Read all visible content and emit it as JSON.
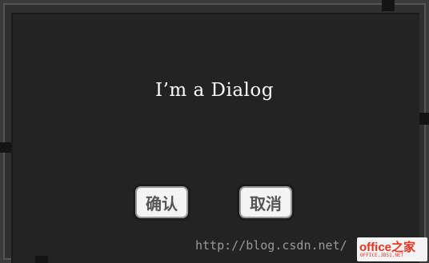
{
  "dialog": {
    "message": "I’m a Dialog",
    "confirm_label": "确认",
    "cancel_label": "取消"
  },
  "overlay": {
    "watermark_url": "http://blog.csdn.net/",
    "brand_logo_text": "office之家",
    "brand_logo_subtext": "OFFICE.JB51.NET"
  },
  "colors": {
    "frame": "#3b3b3b",
    "surface": "#232323",
    "button_face": "#f4f4f4",
    "button_text": "#555555",
    "message_text": "#ffffff",
    "brand_red": "#e8331f"
  }
}
